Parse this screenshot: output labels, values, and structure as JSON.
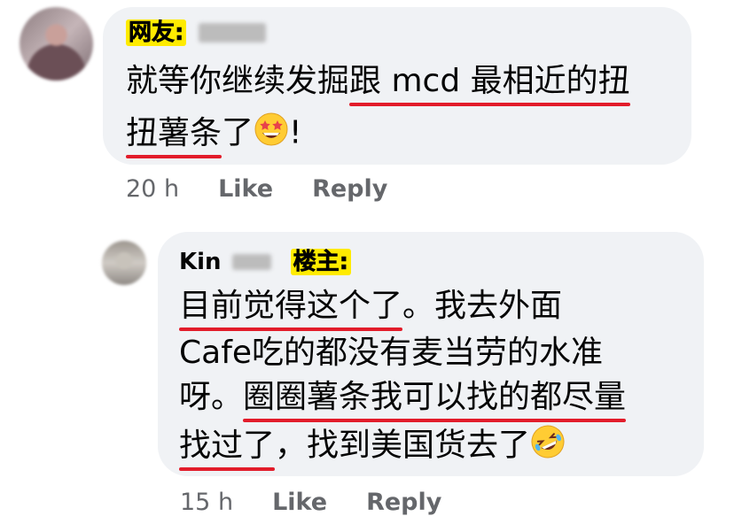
{
  "comments": [
    {
      "tag": "网友:",
      "text": {
        "line1_a": "就等你继续发掘",
        "line1_b": "跟 mcd 最相近的扭",
        "line2_a": "扭薯条",
        "line2_b": "了",
        "line2_c": "!"
      },
      "emoji": "star-struck-emoji",
      "time": "20 h",
      "like": "Like",
      "reply": "Reply"
    },
    {
      "author": "Kin",
      "tag": "楼主:",
      "text": {
        "line1_a": "目前觉得这个了",
        "line1_b": "。我去外面",
        "line2": "Cafe吃的都没有麦当劳的水准",
        "line3_a": "呀。",
        "line3_b": "圈圈薯条我可以找的都尽量",
        "line4_a": "找过了",
        "line4_b": "，找到美国货去了"
      },
      "emoji": "rolling-on-floor-laughing-emoji",
      "time": "15 h",
      "like": "Like",
      "reply": "Reply"
    }
  ],
  "colors": {
    "bubble": "#f0f2f5",
    "underline": "#e21c2a",
    "highlight": "#ffeb00",
    "meta": "#65676b"
  }
}
